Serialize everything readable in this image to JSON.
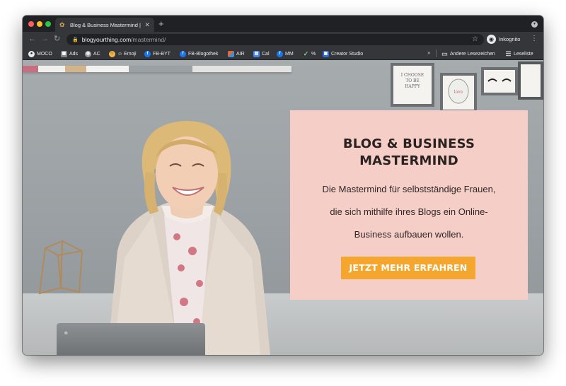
{
  "browser": {
    "tab": {
      "title": "Blog & Business Mastermind |"
    },
    "address": {
      "host": "blogyourthing.com",
      "path": "/mastermind/"
    },
    "profile": {
      "label": "Inkognito"
    },
    "bookmarks": [
      {
        "label": "MOCO",
        "icon": "moco-icon",
        "color": "#3a3b3f"
      },
      {
        "label": "Ads",
        "icon": "ads-icon",
        "color": "#6b6f73"
      },
      {
        "label": "AC",
        "icon": "globe-icon",
        "color": "#5f6368"
      },
      {
        "label": "☺ Emoji",
        "icon": "emoji-icon",
        "color": "#f2b84b"
      },
      {
        "label": "FB-BYT",
        "icon": "facebook-icon",
        "color": "#1877f2"
      },
      {
        "label": "FB-Blogothek",
        "icon": "facebook-icon",
        "color": "#1877f2"
      },
      {
        "label": "AIR",
        "icon": "air-icon",
        "color": "#e2683c"
      },
      {
        "label": "Cal",
        "icon": "calendar-icon",
        "color": "#4285f4"
      },
      {
        "label": "MM",
        "icon": "facebook-icon",
        "color": "#1877f2"
      },
      {
        "label": "%",
        "icon": "check-icon",
        "color": "#3ca55c"
      },
      {
        "label": "Creator Studio",
        "icon": "creator-studio-icon",
        "color": "#2d6bd9"
      }
    ],
    "other_bookmarks": "Andere Lesezeichen",
    "reading_list": "Leseliste"
  },
  "hero": {
    "title_line1": "BLOG & BUSINESS",
    "title_line2": "MASTERMIND",
    "desc_line1": "Die Mastermind für selbstständige Frauen,",
    "desc_line2": "die sich mithilfe ihres Blogs ein Online-",
    "desc_line3": "Business aufbauen wollen.",
    "cta_label": "JETZT MEHR ERFAHREN"
  },
  "decor": {
    "frame_text": "I CHOOSE TO BE HAPPY"
  },
  "colors": {
    "card_bg": "#f6cec8",
    "cta_bg": "#f4a62e",
    "browser_chrome": "#35363a"
  }
}
